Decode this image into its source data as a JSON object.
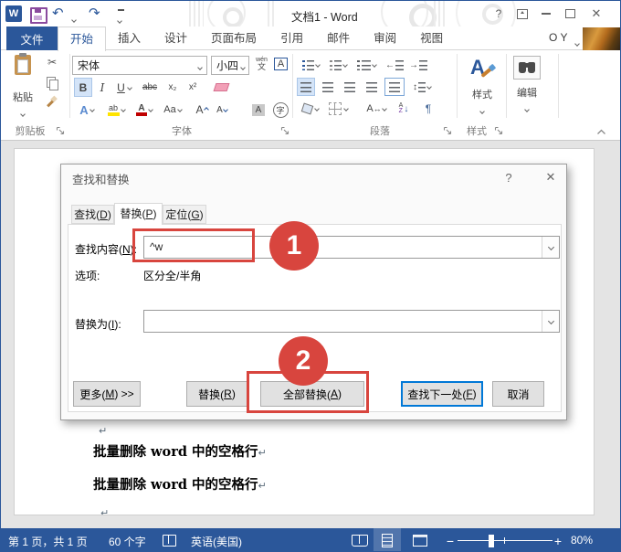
{
  "colors": {
    "word_blue": "#2b579a",
    "annotation_red": "#d8453e",
    "focus_blue": "#0078d7"
  },
  "titlebar": {
    "logo_letter": "W",
    "title": "文档1 - Word",
    "help": "?",
    "close": "✕",
    "undo_glyph": "↶",
    "redo_glyph": "↷",
    "account": "O Y"
  },
  "ribbon_tabs": {
    "file": "文件",
    "items": [
      {
        "label": "开始",
        "state": "active"
      },
      {
        "label": "插入"
      },
      {
        "label": "设计"
      },
      {
        "label": "页面布局"
      },
      {
        "label": "引用"
      },
      {
        "label": "邮件"
      },
      {
        "label": "审阅"
      },
      {
        "label": "视图"
      }
    ]
  },
  "ribbon": {
    "clipboard": {
      "group": "剪贴板",
      "paste": "粘贴",
      "cut_glyph": "✂"
    },
    "font": {
      "group": "字体",
      "name": "宋体",
      "size": "小四",
      "phonetic_top": "wén",
      "phonetic_bottom": "文",
      "char_border": "A",
      "bold": "B",
      "italic": "I",
      "underline": "U",
      "strike": "abc",
      "sub": "x₂",
      "sup": "x²",
      "effects": "A",
      "highlight": "ab",
      "color": "A",
      "case": "Aa",
      "grow": "A",
      "shrink": "A",
      "shade": "A",
      "enclose": "字"
    },
    "paragraph": {
      "group": "段落",
      "indent_left": "←",
      "indent_right": "→",
      "spacing_arrows": "↕",
      "scale_letter": "A",
      "scale_arrows": "↔",
      "sort_a": "A",
      "sort_z": "Z",
      "mark": "¶"
    },
    "styles": {
      "group": "样式",
      "button": "样式",
      "glyph": "A"
    },
    "editing": {
      "button": "编辑"
    }
  },
  "dialog": {
    "title": "查找和替换",
    "help": "?",
    "close": "✕",
    "tabs": [
      {
        "html": "查找(<u>D</u>)"
      },
      {
        "html": "替换(<u>P</u>)",
        "state": "active"
      },
      {
        "html": "定位(<u>G</u>)"
      }
    ],
    "find_label_html": "查找内容(<u>N</u>):",
    "find_value": "^w",
    "options_label": "选项:",
    "options_value": "区分全/半角",
    "replace_label_html": "替换为(<u>I</u>):",
    "replace_value": "",
    "more_html": "更多(<u>M</u>) &gt;&gt;",
    "replace_btn_html": "替换(<u>R</u>)",
    "replace_all_html": "全部替换(<u>A</u>)",
    "find_next_html": "查找下一处(<u>F</u>)",
    "cancel": "取消",
    "step1": "1",
    "step2": "2"
  },
  "document": {
    "mark": "↵",
    "lines": [
      "批量删除 word 中的空格行",
      "批量删除 word 中的空格行"
    ]
  },
  "statusbar": {
    "page_info": "第 1 页，共 1 页",
    "word_count": "60 个字",
    "language": "英语(美国)",
    "minus": "−",
    "plus": "+",
    "zoom_value": "80%"
  }
}
